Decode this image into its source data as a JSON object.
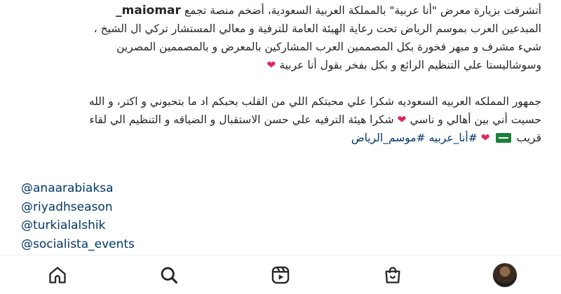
{
  "caption": {
    "username": "maiomar_",
    "line1_text": "أتشرفت بزيارة معرض \"أنا عربية\" بالمملكة العربية السعودية، أضخم منصة تجمع",
    "line2": "المبدعين العرب بموسم الرياض تحت رعاية الهيئة العامة للترفية و معالي المستشار تركي ال الشيخ ،",
    "line3": "شيء مشرف و مبهر فخورة بكل المصممين العرب المشاركين بالمعرض و بالمصممين المصرين",
    "line4_text": "وسوشاليستا علي التنظيم الرائع و بكل بفخر بقول أنا عربية",
    "line5": "جمهور المملكه العربيه السعوديه شكرا علي محبتكم اللي من القلب بحبكم اد ما بتحبوني و اكتر، و الله",
    "line6_text": "حسيت أني بين أهالي و ناسي",
    "line6_text2": "شكرا هيئة الترفيه علي حسن الاستقبال و الضيافه و التنظيم الي لقاء",
    "line7_text": "قريب",
    "hashtags": [
      "#أنا_عربيه",
      "#موسم_الرياض"
    ]
  },
  "mentions": [
    "@anaarabiaksa",
    "@riyadhseason",
    "@turkialalshik",
    "@socialista_events"
  ],
  "icons": {
    "heart": "❤",
    "flag": "saudi-flag-icon"
  },
  "bottom_nav": {
    "items": [
      "home-icon",
      "search-icon",
      "reels-icon",
      "shop-icon",
      "profile-avatar"
    ]
  }
}
